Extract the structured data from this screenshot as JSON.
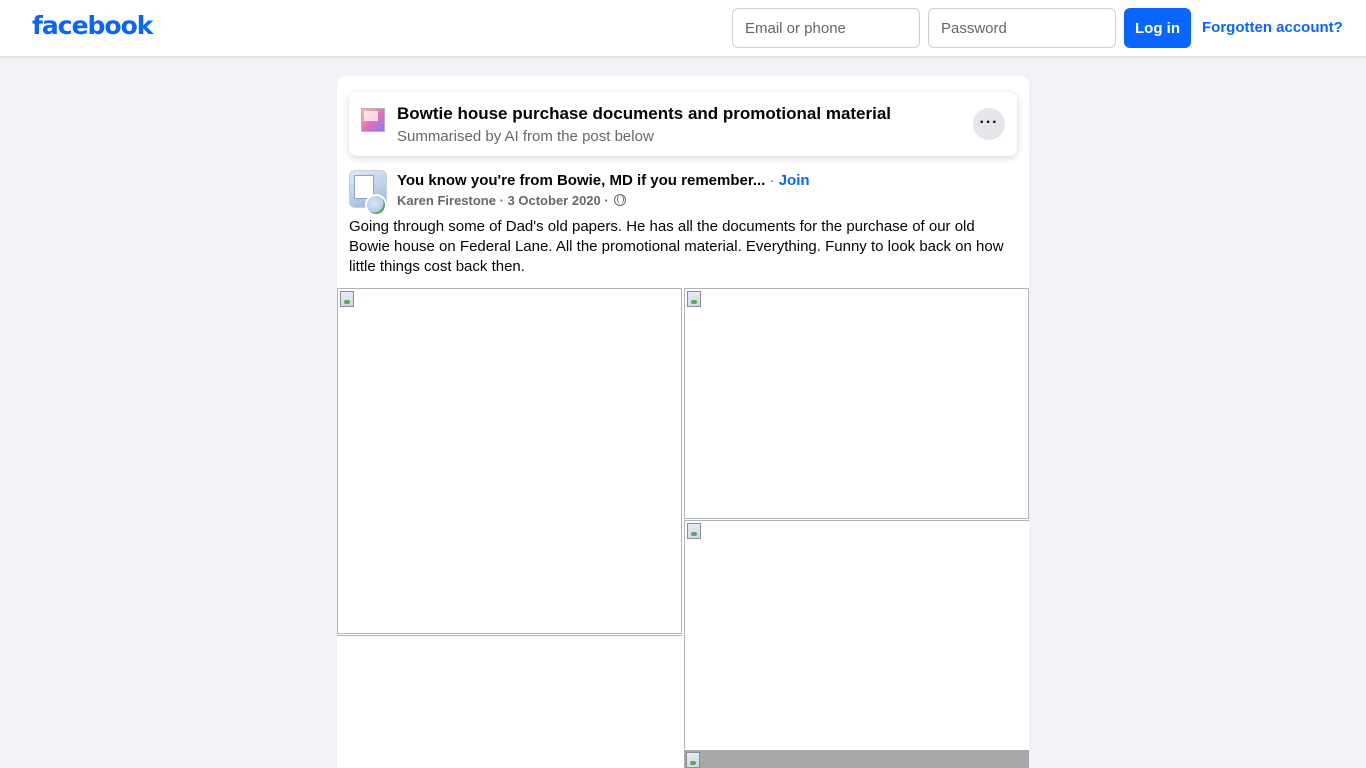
{
  "header": {
    "logo_text": "facebook",
    "email_placeholder": "Email or phone",
    "password_placeholder": "Password",
    "login_label": "Log in",
    "forgot_label": "Forgotten account?"
  },
  "ai_summary": {
    "title": "Bowtie house purchase documents and promotional material",
    "subtitle": "Summarised by AI from the post below",
    "more_label": "···"
  },
  "post": {
    "group_name": "You know you're from Bowie, MD if you remember...",
    "separator": " · ",
    "join_label": "Join",
    "author": "Karen Firestone",
    "date": "3 October 2020",
    "text": "Going through some of Dad's old papers. He has all the documents for the purchase of our old Bowie house on Federal Lane. All the promotional material. Everything. Funny to look back on how little things cost back then."
  },
  "icons": {
    "ai_summary_icon": "ai-sparkle-icon",
    "more_icon": "more-options-icon",
    "privacy_icon": "globe-icon"
  },
  "colors": {
    "brand_blue": "#0866ff",
    "page_background": "#f0f2f5",
    "secondary_text": "#65676b"
  }
}
